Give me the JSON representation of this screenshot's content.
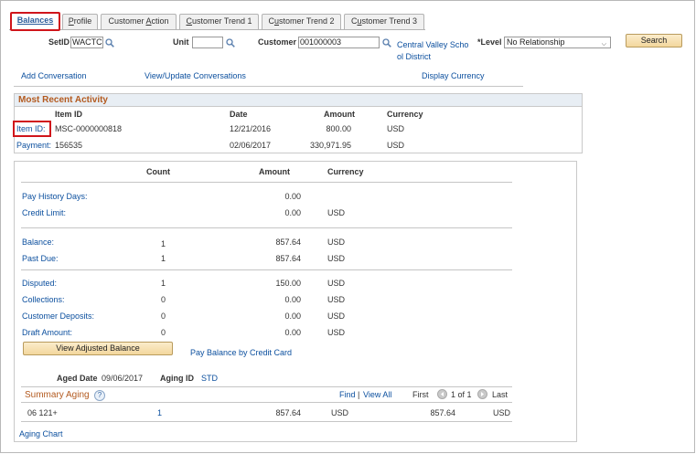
{
  "tabs": [
    {
      "label": "Balances",
      "active": true
    },
    {
      "label": "Profile",
      "underline_idx": 0
    },
    {
      "label": "Customer Action",
      "underline_idx": 9
    },
    {
      "label": "Customer Trend 1",
      "underline_idx": 0
    },
    {
      "label": "Customer Trend 2",
      "underline_idx": 1
    },
    {
      "label": "Customer Trend 3",
      "underline_idx": 1
    }
  ],
  "search": {
    "setid_label": "SetID",
    "setid_value": "WACTC",
    "unit_label": "Unit",
    "unit_value": "",
    "customer_label": "Customer",
    "customer_value": "001000003",
    "customer_name_line1": "Central Valley Scho",
    "customer_name_line2": "ol District",
    "level_label": "*Level",
    "level_value": "No Relationship",
    "search_button": "Search"
  },
  "links": {
    "add_conversation": "Add Conversation",
    "view_update_conversations": "View/Update Conversations",
    "display_currency": "Display Currency"
  },
  "recent_activity": {
    "title": "Most Recent Activity",
    "headers": {
      "item_id": "Item ID",
      "date": "Date",
      "amount": "Amount",
      "currency": "Currency"
    },
    "rows": [
      {
        "label": "Item ID:",
        "id": "MSC-0000000818",
        "date": "12/21/2016",
        "amount": "800.00",
        "currency": "USD"
      },
      {
        "label": "Payment:",
        "id": "156535",
        "date": "02/06/2017",
        "amount": "330,971.95",
        "currency": "USD"
      }
    ]
  },
  "balances": {
    "headers": {
      "count": "Count",
      "amount": "Amount",
      "currency": "Currency"
    },
    "group1": [
      {
        "label": "Pay History Days:",
        "count": "",
        "amount": "0.00",
        "currency": ""
      },
      {
        "label": "Credit Limit:",
        "count": "",
        "amount": "0.00",
        "currency": "USD"
      }
    ],
    "group2": [
      {
        "label": "Balance:",
        "count": "1",
        "amount": "857.64",
        "currency": "USD"
      },
      {
        "label": "Past Due:",
        "count": "1",
        "amount": "857.64",
        "currency": "USD"
      }
    ],
    "group3": [
      {
        "label": "Disputed:",
        "count": "1",
        "amount": "150.00",
        "currency": "USD"
      },
      {
        "label": "Collections:",
        "count": "0",
        "amount": "0.00",
        "currency": "USD"
      },
      {
        "label": "Customer Deposits:",
        "count": "0",
        "amount": "0.00",
        "currency": "USD"
      },
      {
        "label": "Draft Amount:",
        "count": "0",
        "amount": "0.00",
        "currency": "USD"
      }
    ],
    "view_adjusted_balance": "View Adjusted Balance",
    "pay_by_credit_card": "Pay Balance by Credit Card"
  },
  "aging": {
    "aged_date_label": "Aged Date",
    "aged_date_value": "09/06/2017",
    "aging_id_label": "Aging ID",
    "aging_id_value": "STD",
    "summary_title": "Summary Aging",
    "find": "Find",
    "view_all": "View All",
    "first": "First",
    "page_info": "1 of 1",
    "last": "Last",
    "row": {
      "category": "06 121+",
      "count": "1",
      "amount": "857.64",
      "currency": "USD",
      "amount2": "857.64",
      "currency2": "USD"
    },
    "chart_link": "Aging Chart"
  },
  "colors": {
    "accent": "#0b4f9e",
    "highlight": "#d0151b",
    "section_title": "#b35a1f"
  }
}
